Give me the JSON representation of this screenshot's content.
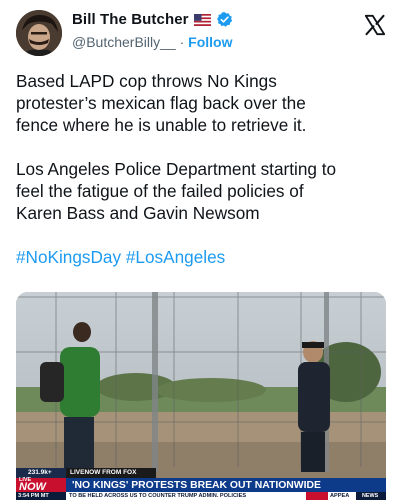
{
  "author": {
    "display_name": "Bill The Butcher",
    "handle": "@ButcherBilly__",
    "separator": "·",
    "follow_label": "Follow",
    "flag_icon": "us-flag-icon",
    "verified_icon": "verified-badge-icon",
    "accent": "#1d9bf0"
  },
  "tweet": {
    "paragraph1": "Based LAPD cop throws No Kings\nprotester’s mexican flag back over the\nfence where he is unable to retrieve it.",
    "paragraph2": "Los Angeles Police Department starting to\nfeel the fatigue of the failed policies of\nKaren Bass and Gavin Newsom",
    "hashtags": "#NoKingsDay #LosAngeles"
  },
  "video": {
    "viewer_count": "231.9k+",
    "source": "LIVENOW FROM FOX",
    "live_badge_top": "LIVE",
    "live_badge_main": "NOW",
    "headline": "'NO KINGS' PROTESTS BREAK OUT NATIONWIDE",
    "time": "3:54 PM MT",
    "subline": "TO BE HELD ACROSS US TO COUNTER TRUMP ADMIN. POLICIES",
    "subline_tail": "APPEA",
    "channel_tag": "NEWS"
  }
}
